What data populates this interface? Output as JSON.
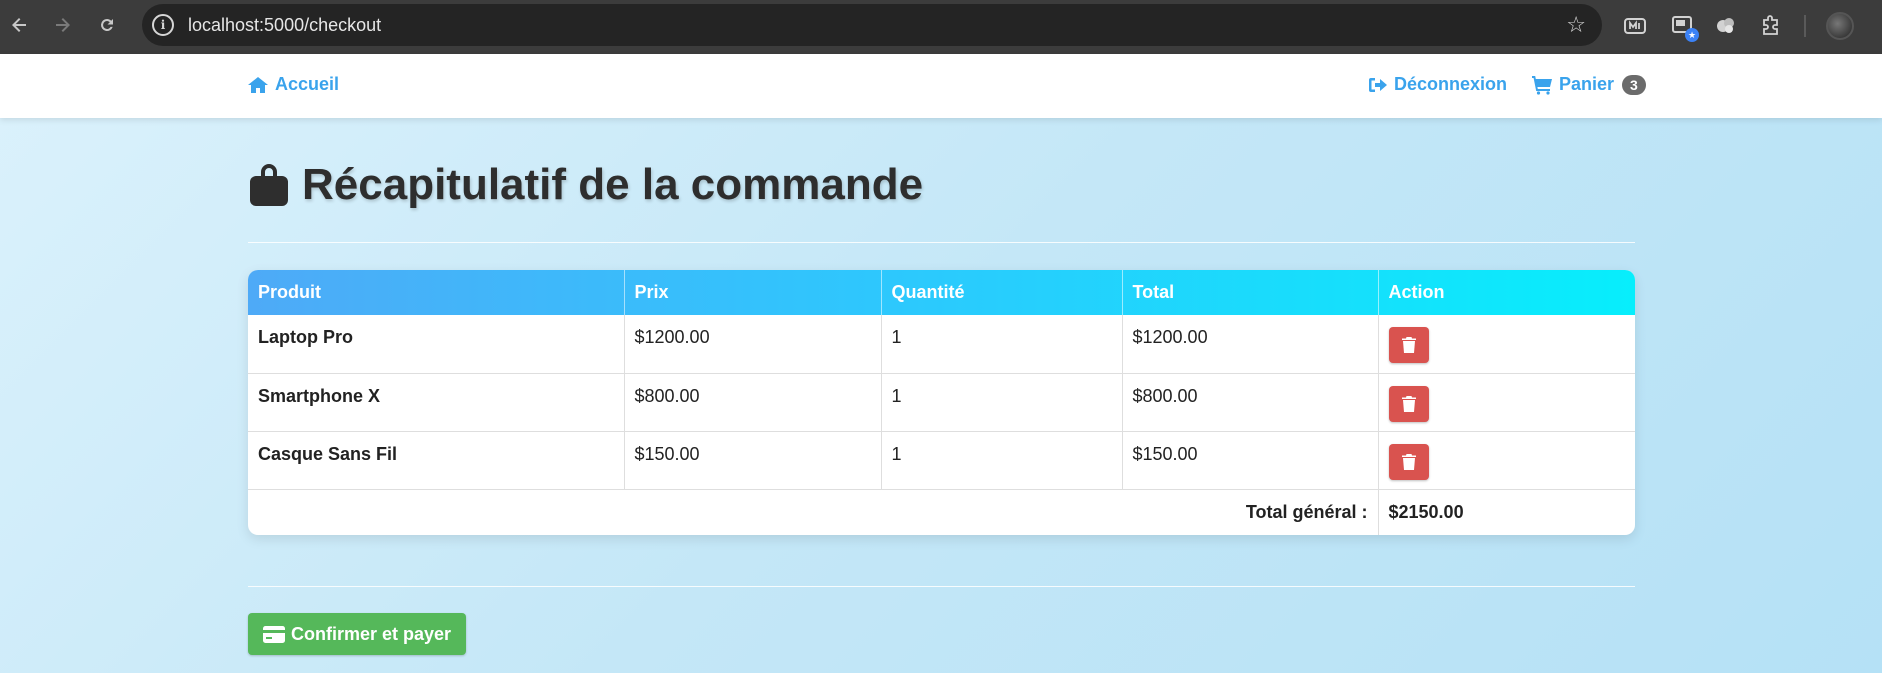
{
  "browser": {
    "url": "localhost:5000/checkout",
    "icons": [
      "back-arrow-icon",
      "forward-arrow-icon",
      "reload-icon",
      "site-info-icon",
      "bookmark-star-icon",
      "extension-icons",
      "profile-avatar"
    ]
  },
  "navbar": {
    "home_label": "Accueil",
    "logout_label": "Déconnexion",
    "cart_label": "Panier",
    "cart_count": "3",
    "link_color": "#3aa3ec"
  },
  "page": {
    "title": "Récapitulatif de la commande"
  },
  "table": {
    "headers": {
      "product": "Produit",
      "price": "Prix",
      "quantity": "Quantité",
      "total": "Total",
      "action": "Action"
    },
    "rows": [
      {
        "product": "Laptop Pro",
        "price": "$1200.00",
        "quantity": "1",
        "total": "$1200.00"
      },
      {
        "product": "Smartphone X",
        "price": "$800.00",
        "quantity": "1",
        "total": "$800.00"
      },
      {
        "product": "Casque Sans Fil",
        "price": "$150.00",
        "quantity": "1",
        "total": "$150.00"
      }
    ],
    "grand_total_label": "Total général :",
    "grand_total_value": "$2150.00",
    "header_gradient": [
      "#4eaaf7",
      "#07eefc"
    ],
    "delete_color": "#d9534f"
  },
  "checkout": {
    "confirm_label": "Confirmer et payer",
    "confirm_color": "#55b85a"
  }
}
